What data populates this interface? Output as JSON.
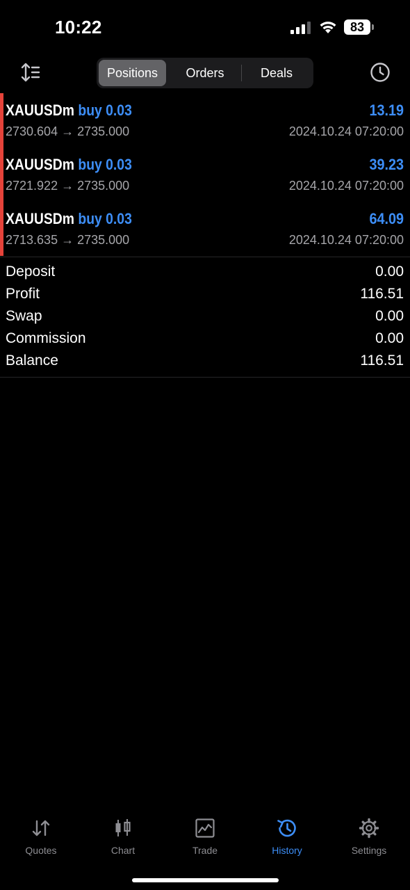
{
  "status_bar": {
    "time": "10:22",
    "battery": "83"
  },
  "toolbar": {
    "segments": [
      "Positions",
      "Orders",
      "Deals"
    ],
    "active_segment": "Positions"
  },
  "positions": [
    {
      "symbol": "XAUUSDm",
      "side": "buy 0.03",
      "profit": "13.19",
      "open_price": "2730.604",
      "close_price": "2735.000",
      "arrow": "→",
      "time": "2024.10.24 07:20:00"
    },
    {
      "symbol": "XAUUSDm",
      "side": "buy 0.03",
      "profit": "39.23",
      "open_price": "2721.922",
      "close_price": "2735.000",
      "arrow": "→",
      "time": "2024.10.24 07:20:00"
    },
    {
      "symbol": "XAUUSDm",
      "side": "buy 0.03",
      "profit": "64.09",
      "open_price": "2713.635",
      "close_price": "2735.000",
      "arrow": "→",
      "time": "2024.10.24 07:20:00"
    }
  ],
  "summary": [
    {
      "label": "Deposit",
      "value": "0.00"
    },
    {
      "label": "Profit",
      "value": "116.51"
    },
    {
      "label": "Swap",
      "value": "0.00"
    },
    {
      "label": "Commission",
      "value": "0.00"
    },
    {
      "label": "Balance",
      "value": "116.51"
    }
  ],
  "tab_bar": {
    "tabs": [
      {
        "label": "Quotes",
        "icon": "quotes-icon"
      },
      {
        "label": "Chart",
        "icon": "chart-icon"
      },
      {
        "label": "Trade",
        "icon": "trade-icon"
      },
      {
        "label": "History",
        "icon": "history-icon"
      },
      {
        "label": "Settings",
        "icon": "settings-icon"
      }
    ],
    "active_tab": "History"
  },
  "colors": {
    "accent": "#3d8ef7",
    "buy_marker": "#e5433a",
    "secondary_text": "#a6a6aa",
    "inactive_tab": "#8e8e93"
  }
}
